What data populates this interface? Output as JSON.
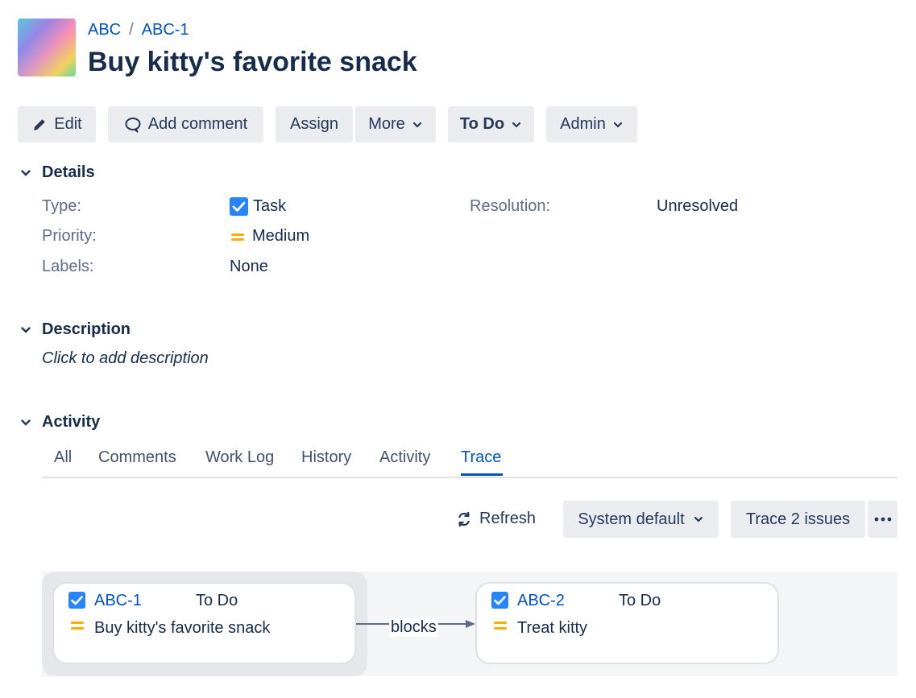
{
  "breadcrumb": {
    "project": "ABC",
    "separator": "/",
    "issue_key": "ABC-1"
  },
  "issue": {
    "summary": "Buy kitty's favorite snack"
  },
  "toolbar": {
    "edit": "Edit",
    "add_comment": "Add comment",
    "assign": "Assign",
    "more": "More",
    "status": "To Do",
    "admin": "Admin"
  },
  "details": {
    "heading": "Details",
    "type_label": "Type:",
    "type_value": "Task",
    "priority_label": "Priority:",
    "priority_value": "Medium",
    "labels_label": "Labels:",
    "labels_value": "None",
    "resolution_label": "Resolution:",
    "resolution_value": "Unresolved"
  },
  "description": {
    "heading": "Description",
    "placeholder": "Click to add description"
  },
  "activity": {
    "heading": "Activity",
    "tabs": [
      "All",
      "Comments",
      "Work Log",
      "History",
      "Activity",
      "Trace"
    ],
    "active_tab": "Trace"
  },
  "trace": {
    "refresh": "Refresh",
    "layout_select": "System default",
    "trace_button": "Trace 2 issues",
    "more_icon": "more-horizontal-icon",
    "edge_label": "blocks",
    "nodes": [
      {
        "key": "ABC-1",
        "status": "To Do",
        "summary": "Buy kitty's favorite snack"
      },
      {
        "key": "ABC-2",
        "status": "To Do",
        "summary": "Treat kitty"
      }
    ]
  },
  "colors": {
    "link": "#0052cc",
    "heading_text": "#172b4d",
    "button_bg": "#ebecf0",
    "task_icon": "#2684ff",
    "priority_medium": "#ffab00"
  }
}
